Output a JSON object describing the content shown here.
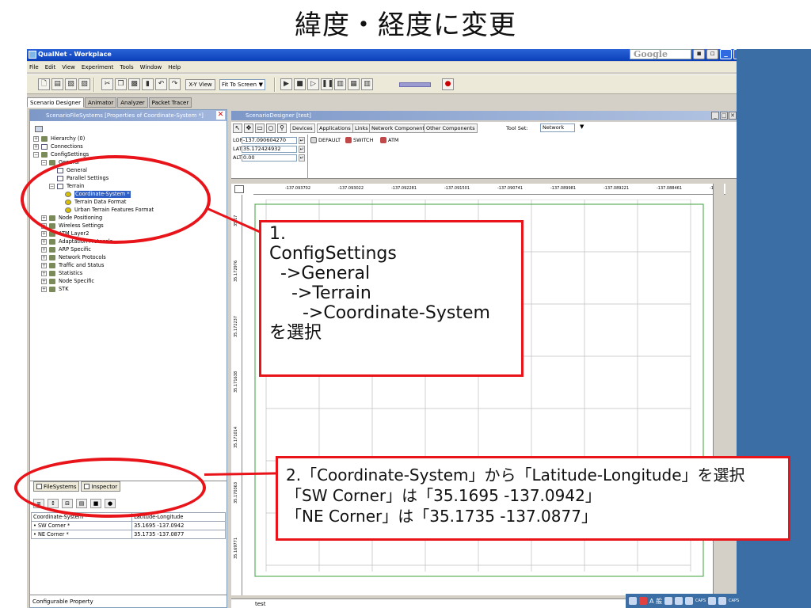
{
  "slide": {
    "title": "緯度・経度に変更"
  },
  "window": {
    "title": "QualNet - Workplace",
    "google_label": "Google",
    "min": "_",
    "max": "□",
    "close": "X",
    "extra_a": "▪",
    "extra_b": "▫"
  },
  "menu": [
    "File",
    "Edit",
    "View",
    "Experiment",
    "Tools",
    "Window",
    "Help"
  ],
  "toolbar": {
    "xy_view": "X-Y View",
    "fit": "Fit To Screen",
    "icons": {
      "new": "🗋",
      "open": "▤",
      "save": "▧",
      "print": "▨",
      "cut": "✂",
      "copy": "❐",
      "paste": "▩",
      "delete": "▮",
      "undo": "↶",
      "redo": "↷",
      "run": "▶",
      "pause": "❚❚",
      "stop": "■",
      "play": "▷",
      "chart": "▥",
      "bar": "▦",
      "record": "●"
    }
  },
  "main_tabs": [
    "Scenario Designer",
    "Animator",
    "Analyzer",
    "Packet Tracer"
  ],
  "left_panel": {
    "title": "ScenarioFileSystems [Properties of Coordinate-System *]",
    "tree": [
      "Hierarchy (0)",
      "Connections",
      "ConfigSettings",
      "General",
      "General",
      "Parallel Settings",
      "Terrain",
      "Coordinate-System *",
      "Terrain Data Format",
      "Urban Terrain Features Format",
      "Node Positioning",
      "Wireless Settings",
      "ATM Layer2",
      "Adaptation Protocols",
      "ARP Specific",
      "Network Protocols",
      "Traffic and Status",
      "Statistics",
      "Node Specific",
      "STK"
    ],
    "tabs": {
      "filesystems": "FileSystems",
      "inspector": "Inspector"
    },
    "properties": [
      {
        "key": "Coordinate-System *",
        "value": "Latitude-Longitude"
      },
      {
        "key": "• SW Corner *",
        "value": "35.1695 -137.0942"
      },
      {
        "key": "• NE Corner *",
        "value": "35.1735 -137.0877"
      }
    ],
    "status": "Configurable Property"
  },
  "designer": {
    "title": "ScenarioDesigner [test]",
    "tabs": [
      "Devices",
      "Applications",
      "Links",
      "Network Components",
      "Other Components"
    ],
    "toolset_label": "Tool Set:",
    "toolset_value": "Network",
    "devices": [
      "DEFAULT",
      "SWITCH",
      "ATM"
    ],
    "lon_label": "LON",
    "lon_value": "-137.090604270",
    "lat_label": "LAT",
    "lat_value": "35.172424932",
    "alt_label": "ALT",
    "alt_value": "0.00",
    "ruler_x": [
      "-137.093702",
      "-137.093022",
      "-137.092281",
      "-137.091501",
      "-137.090741",
      "-137.089981",
      "-137.089221",
      "-137.088461",
      "-137.0"
    ],
    "ruler_y": [
      "35.17",
      "35.172976",
      "35.172237",
      "35.171638",
      "35.171014",
      "35.170363",
      "35.169771"
    ],
    "status": "test"
  },
  "annotations": {
    "callout1": [
      "1.",
      "ConfigSettings",
      "  ->General",
      "    ->Terrain",
      "      ->Coordinate-System",
      "を選択"
    ],
    "callout2": [
      "2.「Coordinate-System」から「Latitude-Longitude」を選択",
      "「SW Corner」は「35.1695 -137.0942」",
      "「NE Corner」は「35.1735 -137.0877」"
    ]
  },
  "taskbar": {
    "ime": "A 般",
    "caps": "CAPS"
  },
  "colors": {
    "annotation_red": "#e8141a",
    "titlebar_blue": "#0a3fb8",
    "canvas_grid": "#bfbfbf",
    "canvas_border": "#3ca03c"
  }
}
